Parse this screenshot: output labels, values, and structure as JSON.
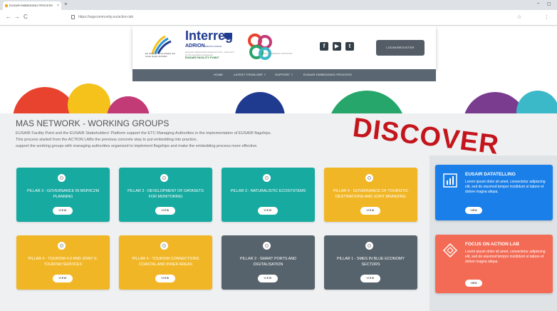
{
  "browser": {
    "tab_title": "EUSAIR EMBEDDING PROCESS",
    "tab_close": "×",
    "new_tab": "+",
    "url": "https://aqpcommunity.eu/action-lab",
    "win_min": "–",
    "win_restore": "▢",
    "nav_back": "←",
    "nav_forward": "→",
    "nav_reload": "C",
    "star": "☆",
    "menu": "⋮"
  },
  "header": {
    "eusair_logo_text": "EU Strategy for the Adriatic and Ionian Region EUSAIR",
    "interreg": "Interreg",
    "adrion": "ADRION",
    "adrion_sub": "ADRIATIC-IONIAN",
    "cofinanced": "European Regional Development Fund · Instrument for Pre-Accession Assistance",
    "facility_point": "EUSAIR FACILITY POINT",
    "mas_logo_text": "MAS EMBEDDING NETWORK",
    "social": {
      "facebook": "f",
      "youtube": "▶",
      "twitter": "t"
    },
    "login_label": "LOGIN/REGISTER"
  },
  "nav": {
    "items": [
      "HOME",
      "LATEST FROM EBP ˅",
      "SUPPORT ˅",
      "EUSAIR EMBEDDING PROCESS"
    ]
  },
  "main": {
    "title": "MAS NETWORK - WORKING GROUPS",
    "desc_line1": "EUSAIR Facility Point and the EUSAIR Stakeholders' Platform support the ETC Managing Authorities in the implementation of EUSAIR flagships.",
    "desc_line2": "This process started from the ACTION LABs the previous concrete step to put embedding into practice,",
    "desc_line3": "support the working groups with managing authorities organized to implement flagships and make the embedding process more effective.",
    "discover": "DISCOVER"
  },
  "cards": [
    {
      "title": "PILLAR 3 - GOVERNANCE IN MSP/ICZM PLANNING",
      "button": "VIEW",
      "color": "#17aaa1"
    },
    {
      "title": "PILLAR 3 - DEVELOPMENT OF DATASETS FOR MONITORING",
      "button": "VIEW",
      "color": "#17aaa1"
    },
    {
      "title": "PILLAR 3 - NATURALISTIC ECOSYSTEMS",
      "button": "VIEW",
      "color": "#17aaa1"
    },
    {
      "title": "PILLAR 4 - GOVERNANCE OF TOURISTIC DESTINATIONS AND JOINT BRANDING",
      "button": "VIEW",
      "color": "#f1b625"
    },
    {
      "title": "PILLAR 4 - TOURISM 4.0 AND JOINT E-TOURISM SERVICES",
      "button": "VIEW",
      "color": "#f1b625"
    },
    {
      "title": "PILLAR 4 - TOURISM CONNECTIONS COASTAL AND INNER AREAS",
      "button": "VIEW",
      "color": "#f1b625"
    },
    {
      "title": "PILLAR 2 - SMART PORTS AND DIGITALISATION",
      "button": "VIEW",
      "color": "#57636c"
    },
    {
      "title": "PILLAR 1 - SMES IN BLUE ECONOMY SECTORS",
      "button": "VIEW",
      "color": "#57636c"
    }
  ],
  "discover_cards": [
    {
      "title": "EUSAIR DATATELLING",
      "text": "Lorem ipsum dolor sit amet, consectetur adipiscing elit, sed do eiusmod tempor incididunt ut labore et dolore magna aliqua.",
      "button": "VIEW",
      "color": "#1a7fe8"
    },
    {
      "title": "FOCUS ON ACTION LAB",
      "text": "Lorem ipsum dolor sit amet, consectetur adipiscing elit, sed do eiusmod tempor incididunt ut labore et dolore magna aliqua.",
      "button": "VIEW",
      "color": "#f46b55"
    }
  ]
}
